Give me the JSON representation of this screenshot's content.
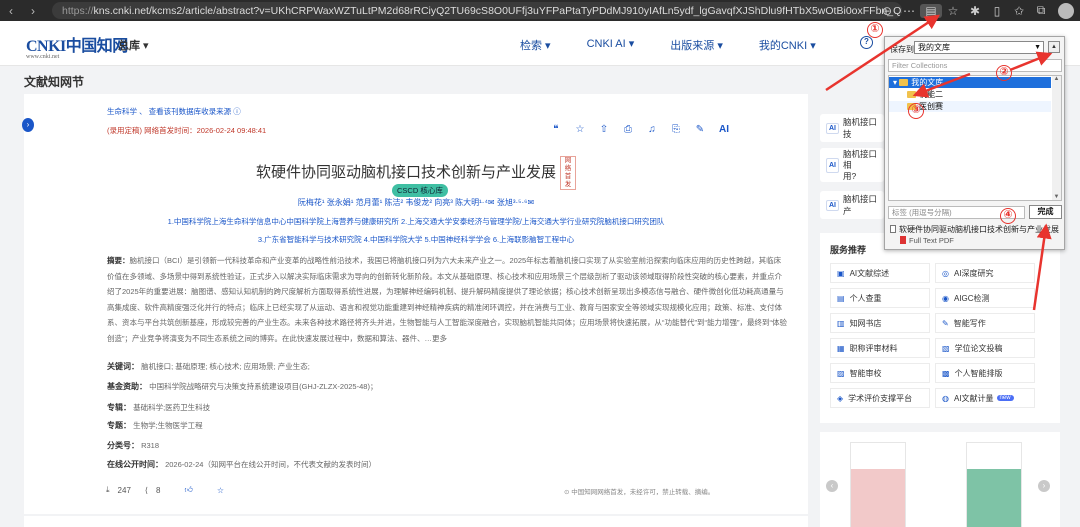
{
  "browser": {
    "url_prefix": "https://",
    "url": "kns.cnki.net/kcms2/article/abstract?v=UKhCRPWaxWZTuLtPM2d68rRCiyQ2TU69cS8O0UFfj3uYFPaPtaTyPDdMJ910yIAfLn5ydf_lgGavqfXJShDlu9fHTbX5wOtBi0oxFFbn_Q3B..."
  },
  "header": {
    "logo_main": "CNKI中国知网",
    "logo_sub": "www.cnki.net",
    "library": "总库 ▾",
    "nav": [
      "检索 ▾",
      "CNKI AI ▾",
      "出版来源 ▾",
      "我的CNKI ▾"
    ]
  },
  "page_title": "文献知网节",
  "article": {
    "crumbs": "生命科学 、 查看该刊数据库收录来源 ⓘ",
    "pub_line": "(录用定稿) 网络首发时间：2026-02-24 09:48:41",
    "toolbar": [
      "❝",
      "☆",
      "⇧",
      "⎙",
      "♫",
      "⎘",
      "✎",
      "AI"
    ],
    "title": "软硬件协同驱动脑机接口技术创新与产业发展",
    "title_badge": "网络首发",
    "cscd": "CSCD 核心库",
    "authors": "阮梅花¹   张永娟¹   范月蕾¹   陈洁²   韦俊龙²   向亮³   陈大明¹·⁴✉   张旭³·⁵·⁶✉",
    "affil1": "1.中国科学院上海生命科学信息中心中国科学院上海营养与健康研究所    2.上海交通大学安泰经济与管理学院/上海交通大学行业研究院脑机接口研究团队",
    "affil2": "3.广东省智能科学与技术研究院    4.中国科学院大学    5.中国神经科学学会    6.上海联影脑智工程中心",
    "abstract_label": "摘要：",
    "abstract": "脑机接口（BCI）是引领新一代科技革命和产业变革的战略性前沿技术，我国已将脑机接口列为六大未来产业之一。2025年标志着脑机接口实现了从实验室前沿探索向临床应用的历史性跨越，其临床价值在多领域、多场景中得到系统性验证，正式步入以解决实际临床需求为导向的创新转化新阶段。本文从基础原理、核心技术和应用场景三个层级剖析了驱动该领域取得阶段性突破的核心要素，并重点介绍了2025年的重要进展：脑图谱、感知认知机制的跨尺度解析方面取得系统性进展，为理解神经编码机制、提升解码精度提供了理论依据；核心技术创新呈现出多模态信号融合、硬件微创化低功耗高通量与高集成度、软件高精度强泛化并行的特点；临床上已经实现了从运动、语言和视觉功能重建到神经精神疾病的精准闭环调控，并在消费与工业、教育与国家安全等领域实现规模化应用；政策、标准、支付体系、资本与平台共筑创新基座，形成较完善的产业生态。未来各种技术路径将齐头并进，生物智能与人工智能深度融合，实现脑机智能共同体；应用场景将快速拓展，从“功能替代”到“能力增强”，最终到“体验创造”；产业竞争将演变为不同生态系统之间的博弈。在此快速发展过程中，数据和算法、器件、…更多",
    "keywords_label": "关键词：",
    "keywords": "脑机接口;  基础原理;  核心技术;  应用场景;  产业生态;",
    "fund_label": "基金资助：",
    "fund": "中国科学院战略研究与决策支持系统建设项目(GHJ-ZLZX-2025-48)；",
    "series_label": "专辑：",
    "series": "基础科学;医药卫生科技",
    "topic_label": "专题：",
    "topic": "生物学;生物医学工程",
    "class_label": "分类号：",
    "class": "R318",
    "online_label": "在线公开时间：",
    "online": "2026-02-24（知网平台在线公开时间，不代表文献的发表时间）",
    "downloads": "247",
    "shares": "8",
    "copyright": "⊙ 中国知网网络首发，未经许可，禁止转载、摘编。",
    "qr_text": "▩▩▩▩"
  },
  "side": {
    "cards": [
      "脑机接口技",
      "脑机接口相\n用?",
      "脑机接口产"
    ],
    "ai_tag": "AI",
    "services_title": "服务推荐",
    "services": [
      {
        "label": "AI文献综述",
        "icon": "▣"
      },
      {
        "label": "AI深度研究",
        "icon": "◎"
      },
      {
        "label": "个人查重",
        "icon": "▤"
      },
      {
        "label": "AIGC检测",
        "icon": "◉"
      },
      {
        "label": "知网书店",
        "icon": "▥"
      },
      {
        "label": "智能写作",
        "icon": "✎"
      },
      {
        "label": "职称评审材料",
        "icon": "▦"
      },
      {
        "label": "学位论文投稿",
        "icon": "▧"
      },
      {
        "label": "智能审校",
        "icon": "▨"
      },
      {
        "label": "个人智能排版",
        "icon": "▩"
      },
      {
        "label": "学术评价支撑平台",
        "icon": "◈"
      },
      {
        "label": "AI文献计量",
        "icon": "◍",
        "badge": "new"
      }
    ]
  },
  "popup": {
    "save_label": "保存到",
    "save_value": "我的文库",
    "filter_placeholder": "Filter Collections",
    "tree": [
      {
        "label": "我的文库",
        "selected": true
      },
      {
        "label": "机能二",
        "selected": false
      },
      {
        "label": "医创赛",
        "selected": false
      }
    ],
    "tags_placeholder": "标签 (用逗号分隔)",
    "done": "完成",
    "item1": "软硬件协同驱动脑机接口技术创新与产业发展",
    "item2": "Full Text PDF"
  },
  "annotations": [
    "①",
    "②",
    "③",
    "④"
  ],
  "colors": {
    "accent": "#1a56c8",
    "annotation": "#e8342e",
    "selection": "#1e6fdc"
  }
}
